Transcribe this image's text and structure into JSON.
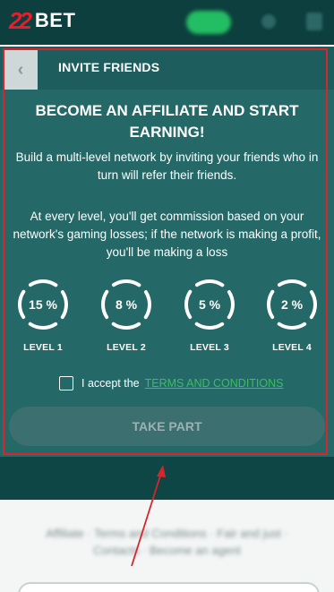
{
  "site": {
    "logo_number": "22",
    "logo_text": "BET",
    "blurred_text": "Affiliate · Terms and Conditions · Fair and just · Contacts · Become an agent"
  },
  "panel": {
    "title": "INVITE FRIENDS",
    "back_icon": "chevron-left-icon",
    "headline": "BECOME AN AFFILIATE AND START EARNING!",
    "description_1": "Build a multi-level network by inviting your friends who in turn will refer their friends.",
    "description_2": "At every level, you'll get commission based on your network's gaming losses; if the network is making a profit, you'll be making a loss",
    "levels": [
      {
        "value": "15 %",
        "label": "LEVEL 1"
      },
      {
        "value": "8 %",
        "label": "LEVEL 2"
      },
      {
        "value": "5 %",
        "label": "LEVEL 3"
      },
      {
        "value": "2 %",
        "label": "LEVEL 4"
      }
    ],
    "accept_text": "I accept the",
    "terms_link": "TERMS AND CONDITIONS",
    "submit_label": "TAKE PART"
  },
  "colors": {
    "panel_bg": "#256868",
    "header_bg": "#0c3f3e",
    "accent_green": "#38c05e",
    "logo_red": "#e51f2d",
    "annotation_red": "#d6262c"
  }
}
